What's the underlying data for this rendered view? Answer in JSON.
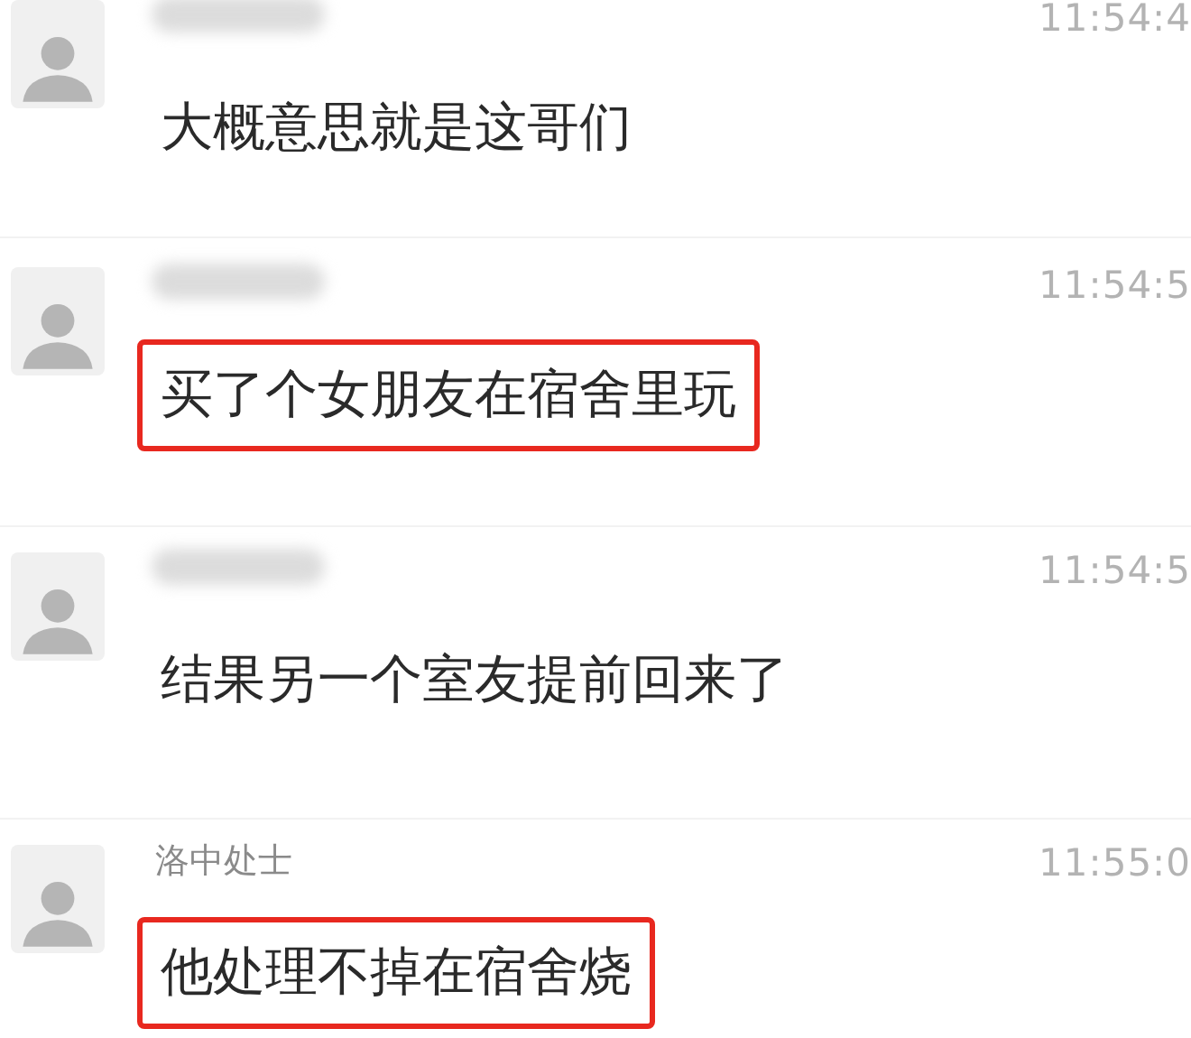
{
  "messages": [
    {
      "time": "11:54:4",
      "text": "大概意思就是这哥们",
      "highlighted": false
    },
    {
      "time": "11:54:5",
      "text": "买了个女朋友在宿舍里玩",
      "highlighted": true
    },
    {
      "time": "11:54:5",
      "text": "结果另一个室友提前回来了",
      "highlighted": false
    },
    {
      "name": "洛中处士",
      "time": "11:55:0",
      "text": "他处理不掉在宿舍烧",
      "highlighted": true
    }
  ]
}
